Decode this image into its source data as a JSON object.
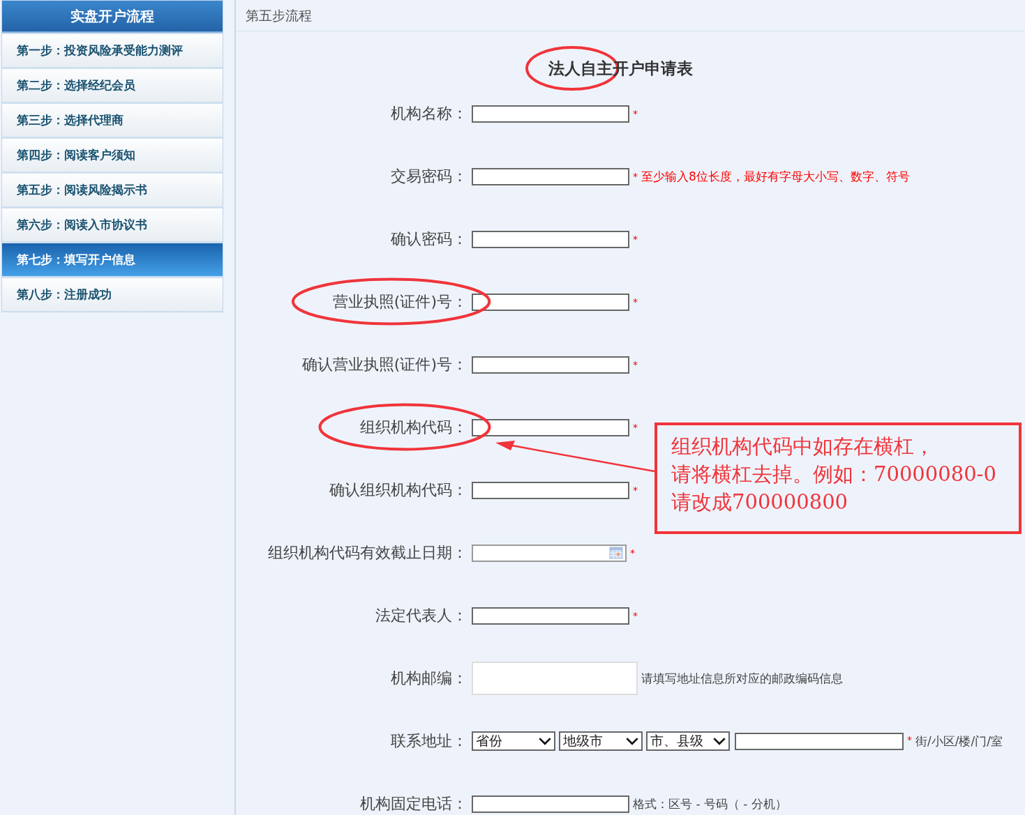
{
  "sidebar": {
    "title": "实盘开户流程",
    "items": [
      {
        "label": "第一步：投资风险承受能力测评",
        "selected": false
      },
      {
        "label": "第二步：选择经纪会员",
        "selected": false
      },
      {
        "label": "第三步：选择代理商",
        "selected": false
      },
      {
        "label": "第四步：阅读客户须知",
        "selected": false
      },
      {
        "label": "第五步：阅读风险揭示书",
        "selected": false
      },
      {
        "label": "第六步：阅读入市协议书",
        "selected": false
      },
      {
        "label": "第七步：填写开户信息",
        "selected": true
      },
      {
        "label": "第八步：注册成功",
        "selected": false
      }
    ]
  },
  "header": "第五步流程",
  "form": {
    "title": "法人自主开户申请表",
    "title_circled": true,
    "rows": [
      {
        "kind": "text",
        "label": "机构名称：",
        "marker": "*",
        "circled": false
      },
      {
        "kind": "text",
        "label": "交易密码：",
        "marker": "*",
        "hint": "至少输入8位长度，最好有字母大小写、数字、符号",
        "hint_alert": true,
        "circled": false
      },
      {
        "kind": "text",
        "label": "确认密码：",
        "marker": "*",
        "circled": false
      },
      {
        "kind": "text",
        "label": "营业执照(证件)号：",
        "marker": "*",
        "circled": true
      },
      {
        "kind": "text",
        "label": "确认营业执照(证件)号：",
        "marker": "*",
        "circled": false
      },
      {
        "kind": "text",
        "label": "组织机构代码：",
        "marker": "*",
        "circled": true
      },
      {
        "kind": "text",
        "label": "确认组织机构代码：",
        "marker": "*",
        "circled": false
      },
      {
        "kind": "date",
        "label": "组织机构代码有效截止日期：",
        "marker": "*",
        "circled": false
      },
      {
        "kind": "text",
        "label": "法定代表人：",
        "marker": "*",
        "circled": false
      },
      {
        "kind": "tall",
        "label": "机构邮编：",
        "hint": "请填写地址信息所对应的邮政编码信息",
        "hint_alert": false,
        "circled": false
      },
      {
        "kind": "address",
        "label": "联系地址：",
        "selects": [
          "省份",
          "地级市",
          "市、县级"
        ],
        "marker": "*",
        "hint": "街/小区/楼/门/室",
        "hint_alert": false,
        "circled": false
      },
      {
        "kind": "text",
        "label": "机构固定电话：",
        "hint": "格式：区号 - 号码（ - 分机）",
        "hint_alert": false,
        "circled": false
      }
    ]
  },
  "callout": {
    "lines": [
      "组织机构代码中如存在横杠，",
      "请将横杠去掉。例如：70000080-0",
      "请改成700000800"
    ]
  }
}
